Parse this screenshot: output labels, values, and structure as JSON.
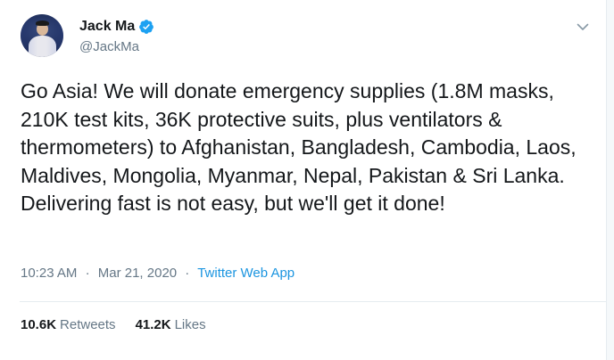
{
  "tweet": {
    "author": {
      "display_name": "Jack Ma",
      "handle": "@JackMa",
      "verified": true,
      "verified_icon": "verified-badge-icon",
      "avatar_icon": "profile-photo"
    },
    "text": "Go Asia! We will donate emergency supplies (1.8M masks, 210K test kits, 36K protective suits, plus ventilators & thermometers) to Afghanistan, Bangladesh, Cambodia, Laos, Maldives, Mongolia, Myanmar, Nepal, Pakistan & Sri Lanka. Delivering fast is not easy, but we'll get it done!",
    "time": "10:23 AM",
    "date": "Mar 21, 2020",
    "separator": "·",
    "source": "Twitter Web App",
    "retweets_count": "10.6K",
    "retweets_label": "Retweets",
    "likes_count": "41.2K",
    "likes_label": "Likes",
    "menu_icon": "chevron-down-icon"
  },
  "colors": {
    "text_primary": "#14171a",
    "text_secondary": "#657786",
    "link": "#1b95e0",
    "verified": "#1da1f2",
    "divider": "#e6ecf0"
  }
}
